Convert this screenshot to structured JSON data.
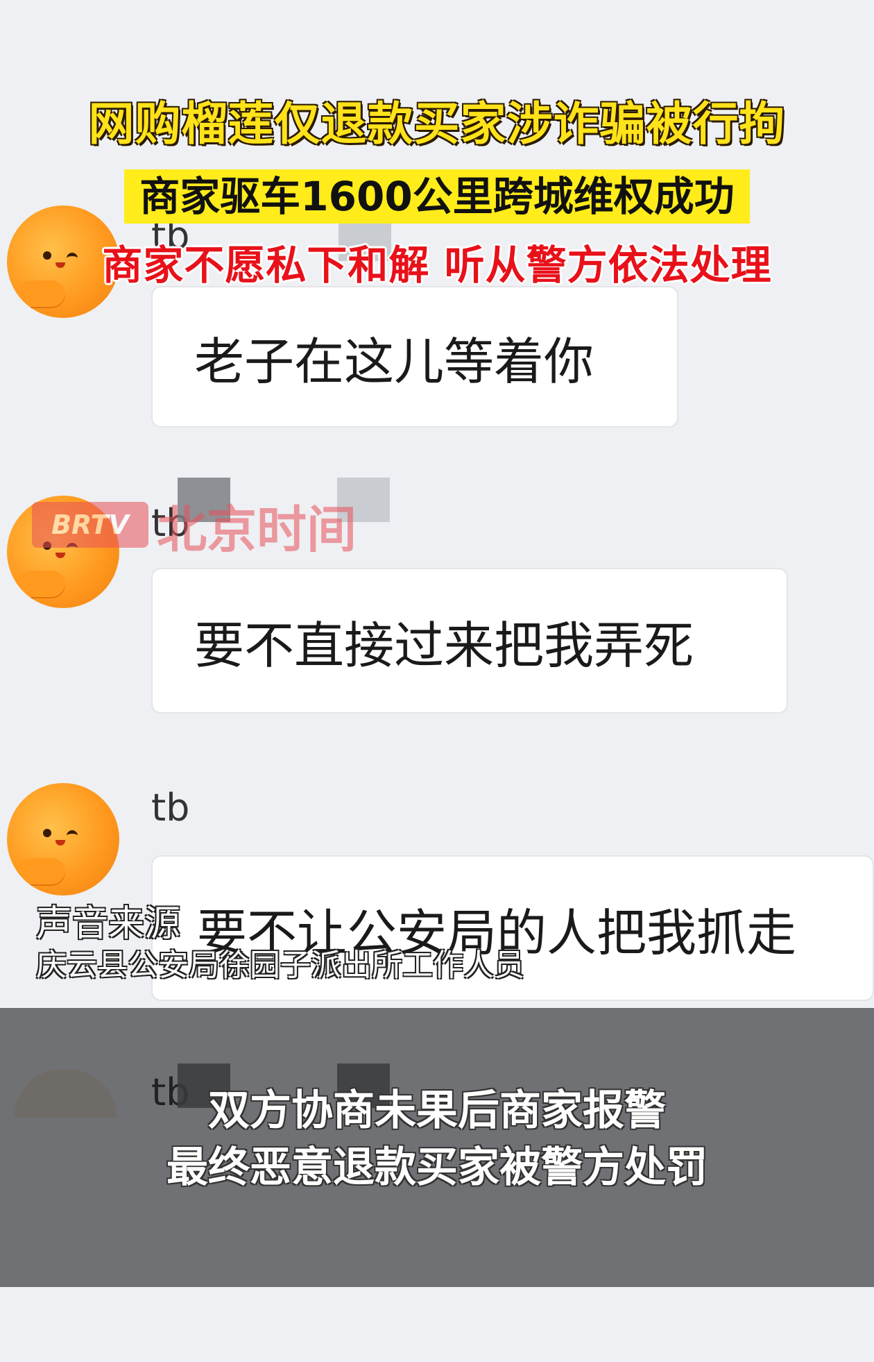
{
  "headline": {
    "line1": "网购榴莲仅退款买家涉诈骗被行拘",
    "line2": "商家驱车1600公里跨城维权成功",
    "line3": "商家不愿私下和解  听从警方依法处理"
  },
  "watermark": {
    "logo": "BRTV",
    "text": "北京时间"
  },
  "messages": [
    {
      "user": "tb",
      "text": "老子在这儿等着你"
    },
    {
      "user": "tb",
      "text": "要不直接过来把我弄死"
    },
    {
      "user": "tb",
      "text": "要不让公安局的人把我抓走"
    },
    {
      "user": "tb"
    }
  ],
  "source": {
    "label": "声音来源",
    "detail": "庆云县公安局徐园子派出所工作人员"
  },
  "caption": {
    "line1": "双方协商未果后商家报警",
    "line2": "最终恶意退款买家被警方处罚"
  },
  "colors": {
    "headline_yellow": "#ffe21a",
    "headline_red": "#e8111a",
    "avatar_orange": "#ff9a1f",
    "overlay_gray": "#64666a"
  }
}
